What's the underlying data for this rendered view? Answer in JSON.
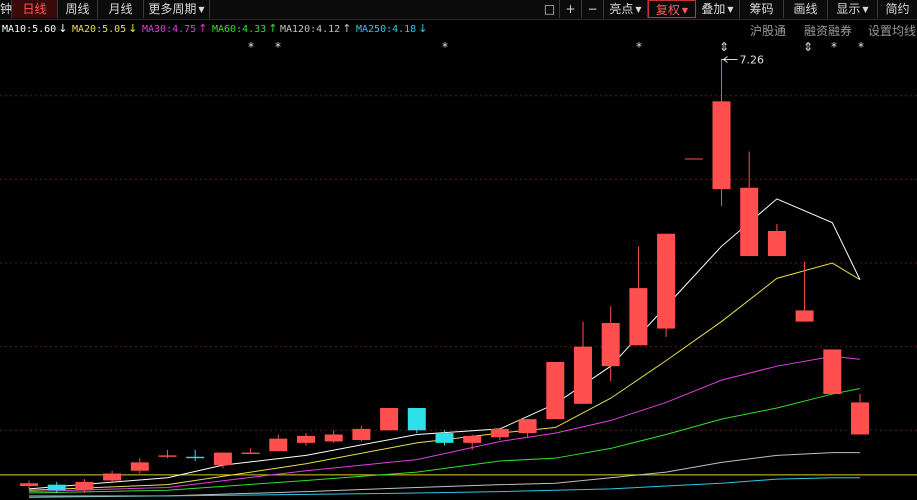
{
  "toolbar": {
    "left_glyph": "钟",
    "tabs": [
      {
        "label": "日线",
        "active": true
      },
      {
        "label": "周线",
        "active": false
      },
      {
        "label": "月线",
        "active": false
      },
      {
        "label": "更多周期",
        "active": false
      }
    ],
    "right_buttons": [
      {
        "label": "□"
      },
      {
        "label": "+"
      },
      {
        "label": "−"
      },
      {
        "label": "亮点"
      },
      {
        "label": "复权"
      },
      {
        "label": "叠加"
      },
      {
        "label": "筹码"
      },
      {
        "label": "画线"
      },
      {
        "label": "显示"
      },
      {
        "label": "简约"
      }
    ]
  },
  "ma_legend": [
    {
      "text": "MA10:5.60",
      "arrow": "↓",
      "color": "#ffffff"
    },
    {
      "text": "MA20:5.05",
      "arrow": "↓",
      "color": "#e8e04a"
    },
    {
      "text": "MA30:4.75",
      "arrow": "↑",
      "color": "#e040e0"
    },
    {
      "text": "MA60:4.33",
      "arrow": "↑",
      "color": "#30e030"
    },
    {
      "text": "MA120:4.12",
      "arrow": "↑",
      "color": "#c0c0c0"
    },
    {
      "text": "MA250:4.18",
      "arrow": "↓",
      "color": "#30c8e8"
    }
  ],
  "right_links": [
    "沪股通",
    "融资融券",
    "设置均线"
  ],
  "event_markers": [
    "*",
    "*",
    "*",
    "*",
    "⇕",
    "⇕",
    "*",
    "*"
  ],
  "high_label": "7.26",
  "chart_data": {
    "type": "candlestick",
    "candles": [
      {
        "o": 4.2,
        "c": 4.22,
        "h": 4.24,
        "l": 4.18
      },
      {
        "o": 4.21,
        "c": 4.17,
        "h": 4.23,
        "l": 4.15
      },
      {
        "o": 4.17,
        "c": 4.23,
        "h": 4.25,
        "l": 4.15
      },
      {
        "o": 4.24,
        "c": 4.29,
        "h": 4.31,
        "l": 4.23
      },
      {
        "o": 4.31,
        "c": 4.37,
        "h": 4.4,
        "l": 4.29
      },
      {
        "o": 4.41,
        "c": 4.42,
        "h": 4.46,
        "l": 4.4
      },
      {
        "o": 4.41,
        "c": 4.4,
        "h": 4.46,
        "l": 4.38
      },
      {
        "o": 4.35,
        "c": 4.44,
        "h": 4.44,
        "l": 4.33
      },
      {
        "o": 4.43,
        "c": 4.44,
        "h": 4.47,
        "l": 4.43
      },
      {
        "o": 4.45,
        "c": 4.54,
        "h": 4.57,
        "l": 4.45
      },
      {
        "o": 4.51,
        "c": 4.56,
        "h": 4.58,
        "l": 4.49
      },
      {
        "o": 4.52,
        "c": 4.57,
        "h": 4.6,
        "l": 4.51
      },
      {
        "o": 4.53,
        "c": 4.61,
        "h": 4.63,
        "l": 4.52
      },
      {
        "o": 4.6,
        "c": 4.76,
        "h": 4.76,
        "l": 4.6
      },
      {
        "o": 4.76,
        "c": 4.6,
        "h": 4.76,
        "l": 4.58
      },
      {
        "o": 4.58,
        "c": 4.51,
        "h": 4.6,
        "l": 4.49
      },
      {
        "o": 4.51,
        "c": 4.56,
        "h": 4.57,
        "l": 4.46
      },
      {
        "o": 4.55,
        "c": 4.61,
        "h": 4.62,
        "l": 4.53
      },
      {
        "o": 4.58,
        "c": 4.68,
        "h": 4.68,
        "l": 4.55
      },
      {
        "o": 4.68,
        "c": 5.09,
        "h": 5.09,
        "l": 4.68
      },
      {
        "o": 4.79,
        "c": 5.2,
        "h": 5.38,
        "l": 4.79
      },
      {
        "o": 5.06,
        "c": 5.37,
        "h": 5.49,
        "l": 4.95
      },
      {
        "o": 5.21,
        "c": 5.62,
        "h": 5.92,
        "l": 5.21
      },
      {
        "o": 5.33,
        "c": 6.01,
        "h": 6.01,
        "l": 5.27
      },
      {
        "o": 6.55,
        "c": 6.55,
        "h": 6.55,
        "l": 6.55
      },
      {
        "o": 6.33,
        "c": 6.96,
        "h": 7.26,
        "l": 6.21
      },
      {
        "o": 5.85,
        "c": 6.34,
        "h": 6.6,
        "l": 5.85
      },
      {
        "o": 5.85,
        "c": 6.03,
        "h": 6.08,
        "l": 5.85
      },
      {
        "o": 5.38,
        "c": 5.46,
        "h": 5.81,
        "l": 5.38
      },
      {
        "o": 4.86,
        "c": 5.18,
        "h": 5.18,
        "l": 4.86
      },
      {
        "o": 4.57,
        "c": 4.8,
        "h": 4.86,
        "l": 4.57
      }
    ],
    "ma_series": [
      {
        "name": "MA10",
        "color": "#ffffff",
        "x": [
          0,
          5,
          7,
          10,
          14,
          17,
          19,
          21,
          23,
          25,
          27,
          29,
          30
        ],
        "y": [
          4.18,
          4.26,
          4.35,
          4.42,
          4.57,
          4.61,
          4.79,
          5.06,
          5.49,
          5.92,
          6.26,
          6.09,
          5.68
        ]
      },
      {
        "name": "MA20",
        "color": "#e8e04a",
        "x": [
          0,
          5,
          10,
          14,
          17,
          19,
          21,
          23,
          25,
          27,
          29,
          30
        ],
        "y": [
          4.17,
          4.21,
          4.36,
          4.51,
          4.58,
          4.62,
          4.83,
          5.1,
          5.38,
          5.69,
          5.8,
          5.68
        ]
      },
      {
        "name": "MA30",
        "color": "#e040e0",
        "x": [
          0,
          5,
          10,
          14,
          17,
          19,
          21,
          23,
          25,
          27,
          29,
          30
        ],
        "y": [
          4.16,
          4.19,
          4.31,
          4.39,
          4.52,
          4.58,
          4.67,
          4.8,
          4.96,
          5.06,
          5.13,
          5.11
        ]
      },
      {
        "name": "MA60",
        "color": "#30e030",
        "x": [
          0,
          5,
          10,
          14,
          17,
          19,
          21,
          23,
          25,
          27,
          29,
          30
        ],
        "y": [
          4.15,
          4.17,
          4.24,
          4.3,
          4.38,
          4.4,
          4.47,
          4.57,
          4.68,
          4.76,
          4.86,
          4.9
        ]
      },
      {
        "name": "MA120",
        "color": "#c0c0c0",
        "x": [
          0,
          5,
          10,
          14,
          17,
          19,
          21,
          23,
          25,
          27,
          29,
          30
        ],
        "y": [
          4.12,
          4.13,
          4.16,
          4.19,
          4.21,
          4.22,
          4.26,
          4.3,
          4.37,
          4.42,
          4.44,
          4.44
        ]
      },
      {
        "name": "MA250",
        "color": "#30c8e8",
        "x": [
          0,
          5,
          10,
          14,
          17,
          19,
          21,
          23,
          25,
          27,
          29,
          30
        ],
        "y": [
          4.13,
          4.13,
          4.14,
          4.15,
          4.16,
          4.17,
          4.18,
          4.2,
          4.22,
          4.25,
          4.26,
          4.26
        ]
      }
    ],
    "yellow_ref": 4.28,
    "ylim": [
      4.1,
      7.4
    ],
    "gridlines": [
      7.0,
      6.4,
      5.8,
      5.2,
      4.6
    ]
  }
}
